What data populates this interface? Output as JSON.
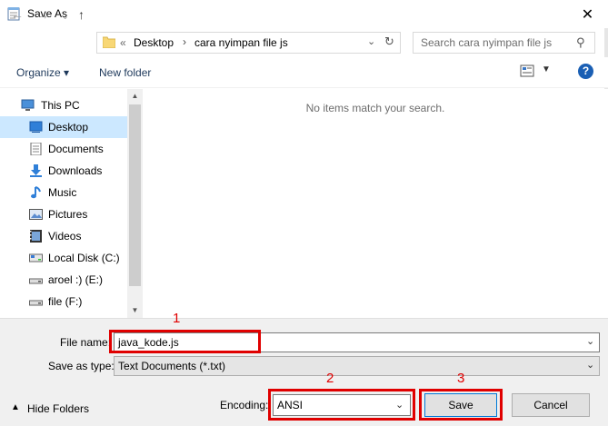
{
  "window": {
    "title": "Save As"
  },
  "nav": {
    "back_icon": "arrow-left-icon",
    "forward_icon": "arrow-right-icon",
    "recent_icon": "chevron-down-icon",
    "up_icon": "arrow-up-icon"
  },
  "address": {
    "overflow": "«",
    "crumbs": [
      "Desktop",
      "cara nyimpan file js"
    ]
  },
  "search": {
    "placeholder": "Search cara nyimpan file js"
  },
  "toolbar": {
    "organize": "Organize ▾",
    "new_folder": "New folder"
  },
  "sidebar": {
    "items": [
      {
        "label": "This PC",
        "icon": "computer-icon"
      },
      {
        "label": "Desktop",
        "icon": "desktop-icon",
        "selected": true
      },
      {
        "label": "Documents",
        "icon": "documents-icon"
      },
      {
        "label": "Downloads",
        "icon": "download-icon"
      },
      {
        "label": "Music",
        "icon": "music-icon"
      },
      {
        "label": "Pictures",
        "icon": "pictures-icon"
      },
      {
        "label": "Videos",
        "icon": "videos-icon"
      },
      {
        "label": "Local Disk (C:)",
        "icon": "drive-icon"
      },
      {
        "label": "aroel :) (E:)",
        "icon": "removable-drive-icon"
      },
      {
        "label": "file (F:)",
        "icon": "removable-drive-icon"
      }
    ]
  },
  "content": {
    "empty_message": "No items match your search."
  },
  "form": {
    "filename_label": "File name:",
    "filename_value": "java_kode.js",
    "type_label": "Save as type:",
    "type_value": "Text Documents (*.txt)",
    "encoding_label": "Encoding:",
    "encoding_value": "ANSI"
  },
  "footer": {
    "hide_folders": "Hide Folders",
    "save": "Save",
    "cancel": "Cancel"
  },
  "annotations": [
    "1",
    "2",
    "3"
  ],
  "colors": {
    "highlight": "#e00000",
    "selected": "#cce8ff",
    "accent": "#0078d7"
  }
}
